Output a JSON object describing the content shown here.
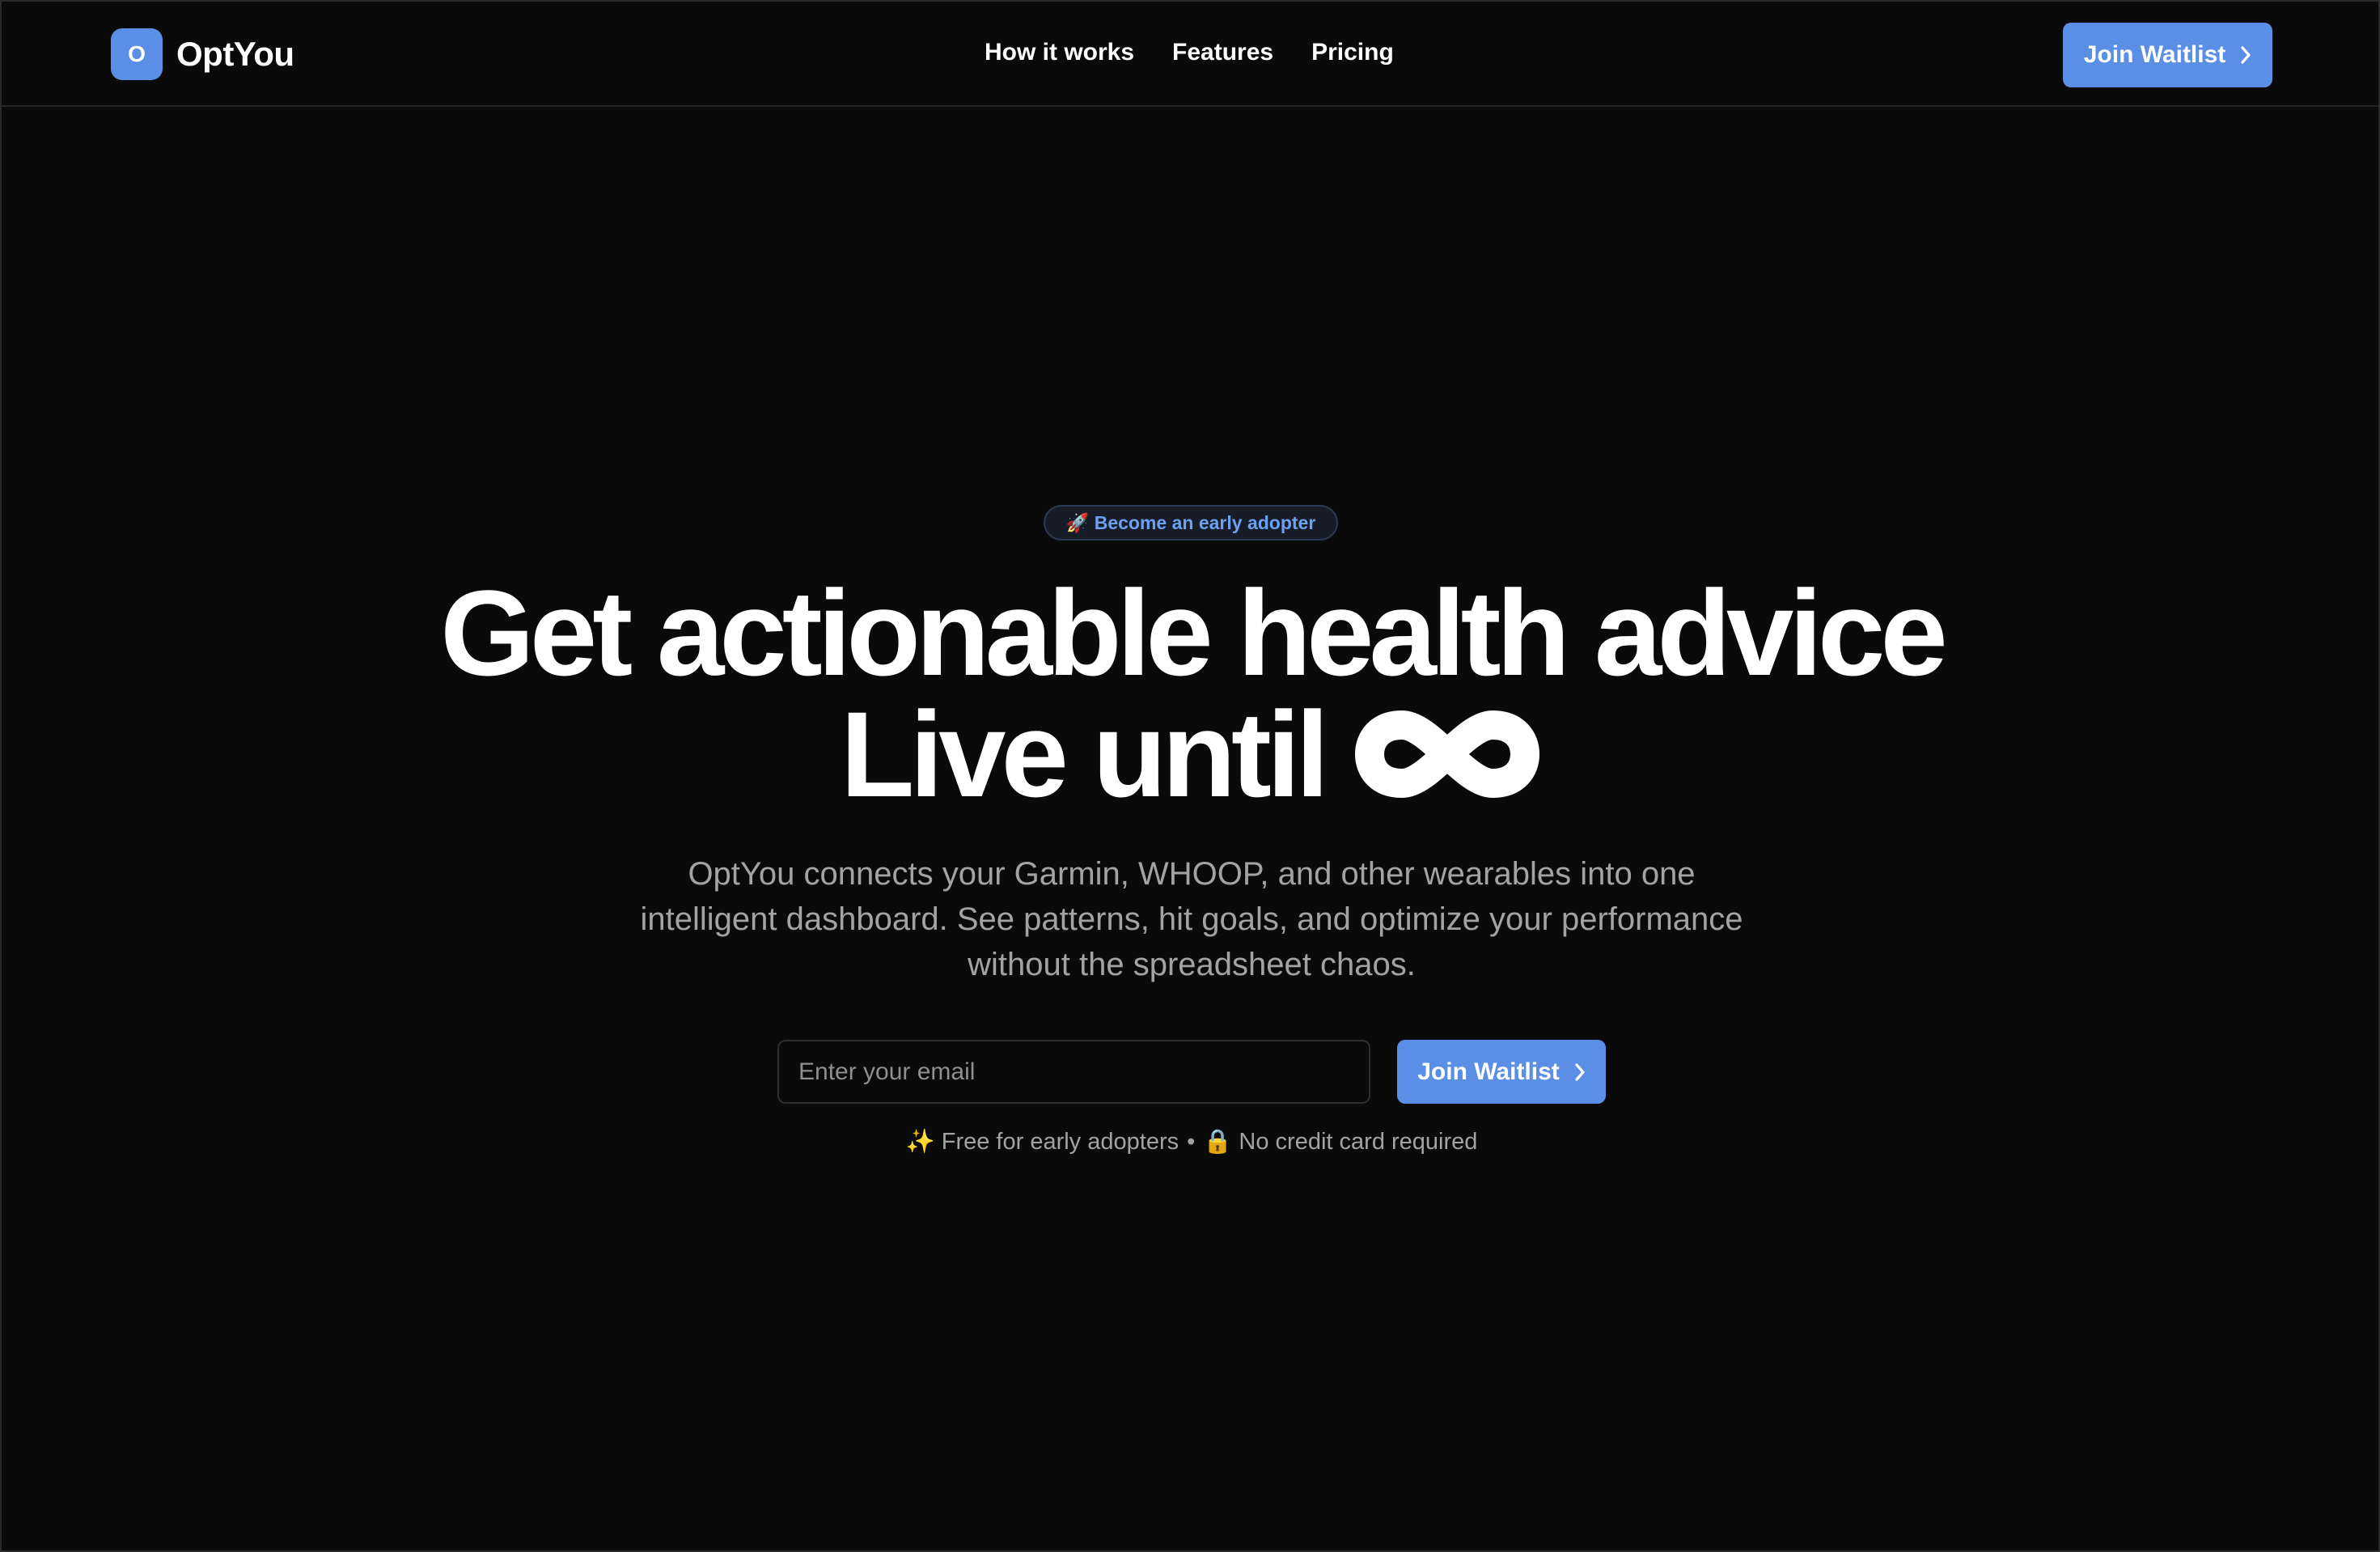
{
  "header": {
    "brand_initial": "O",
    "brand_name": "OptYou",
    "nav": [
      {
        "label": "How it works"
      },
      {
        "label": "Features"
      },
      {
        "label": "Pricing"
      }
    ],
    "cta_label": "Join Waitlist"
  },
  "hero": {
    "badge_icon": "rocket-icon",
    "badge_text": "🚀 Become an early adopter",
    "headline_line1": "Get actionable health advice",
    "headline_line2_text": "Live until",
    "headline_line2_icon": "infinity-icon",
    "subtext": "OptYou connects your Garmin, WHOOP, and other wearables into one intelligent dashboard. See patterns, hit goals, and optimize your performance without the spreadsheet chaos.",
    "email_placeholder": "Enter your email",
    "email_value": "",
    "cta_label": "Join Waitlist",
    "fineprint_part1": "✨ Free for early adopters",
    "fineprint_separator": "•",
    "fineprint_part2": "🔒 No credit card required"
  },
  "colors": {
    "background": "#0a0a0a",
    "accent": "#5b8fe6",
    "text_primary": "#ffffff",
    "text_muted": "#a3a3a3",
    "badge_text": "#6ea0f0"
  }
}
